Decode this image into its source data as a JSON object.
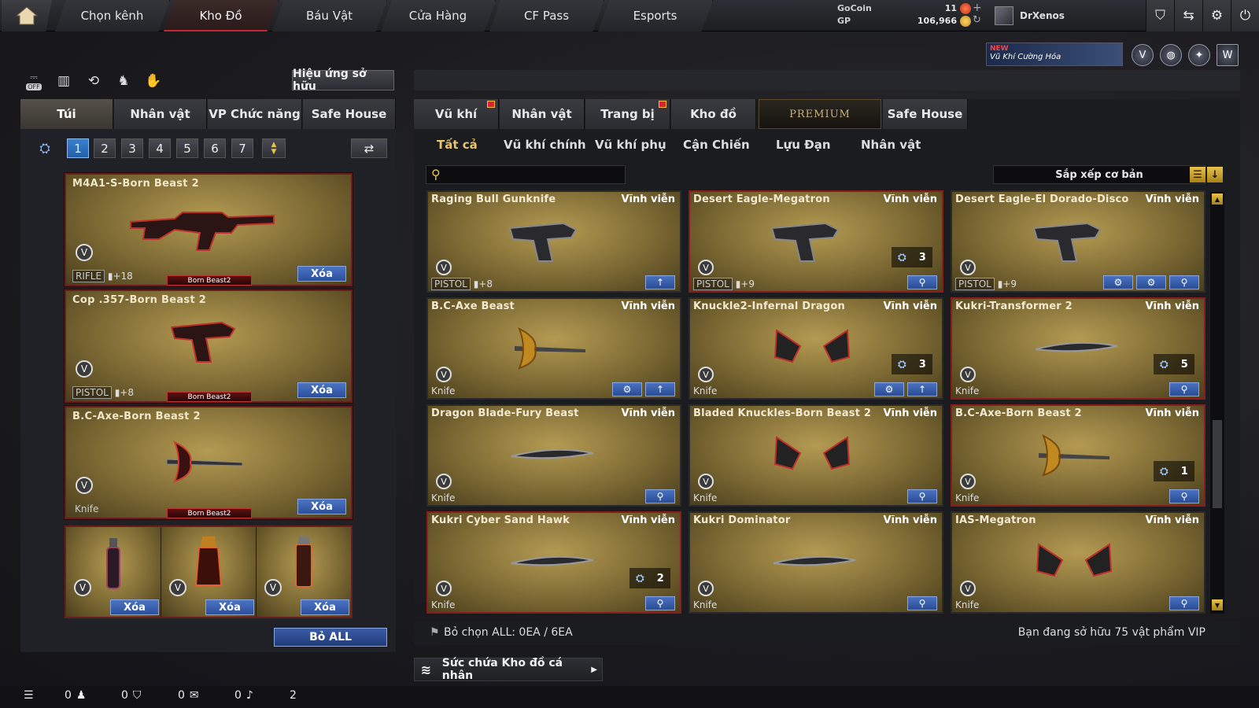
{
  "nav": {
    "tabs": [
      "Chọn kênh",
      "Kho Đồ",
      "Báu Vật",
      "Cửa Hàng",
      "CF Pass",
      "Esports"
    ],
    "active": "Kho Đồ"
  },
  "currency": {
    "gocoin_label": "GoCoin",
    "gp_label": "GP",
    "gocoin_value": "11",
    "gp_value": "106,966"
  },
  "user": {
    "name": "DrXenos"
  },
  "promo": {
    "badge": "NEW",
    "text": "Vũ Khí Cường Hóa"
  },
  "left": {
    "effect_button": "Hiệu ứng sở hữu",
    "toggle_label": "OFF",
    "tabs": [
      "Túi",
      "Nhân vật",
      "VP Chức năng",
      "Safe House"
    ],
    "slots": [
      "1",
      "2",
      "3",
      "4",
      "5",
      "6",
      "7"
    ],
    "cards": [
      {
        "name": "M4A1-S-Born Beast 2",
        "cat": "RIFLE",
        "lvl": "+18",
        "tag": "Born Beast2",
        "del": "Xóa"
      },
      {
        "name": "Cop .357-Born Beast 2",
        "cat": "PISTOL",
        "lvl": "+8",
        "tag": "Born Beast2",
        "del": "Xóa"
      },
      {
        "name": "B.C-Axe-Born Beast 2",
        "cat": "Knife",
        "lvl": "",
        "tag": "Born Beast2",
        "del": "Xóa"
      }
    ],
    "grenades": [
      {
        "del": "Xóa"
      },
      {
        "del": "Xóa"
      },
      {
        "del": "Xóa"
      }
    ],
    "bo_all": "Bỏ ALL"
  },
  "right": {
    "tabs": [
      "Vũ khí",
      "Nhân vật",
      "Trang bị",
      "Kho đồ",
      "PREMIUM",
      "Safe House"
    ],
    "subtabs": [
      "Tất cả",
      "Vũ khí chính",
      "Vũ khí phụ",
      "Cận Chiến",
      "Lựu Đạn",
      "Nhân vật"
    ],
    "sort_label": "Sắp xếp cơ bản",
    "items": [
      {
        "name": "Raging Bull Gunknife",
        "perm": "Vĩnh viễn",
        "cat": "PISTOL",
        "lvl": "+8",
        "qty": ""
      },
      {
        "name": "Desert Eagle-Megatron",
        "perm": "Vĩnh viễn",
        "cat": "PISTOL",
        "lvl": "+9",
        "qty": "3"
      },
      {
        "name": "Desert Eagle-El Dorado-Disco",
        "perm": "Vĩnh viễn",
        "cat": "PISTOL",
        "lvl": "+9",
        "qty": ""
      },
      {
        "name": "B.C-Axe Beast",
        "perm": "Vĩnh viễn",
        "cat": "Knife",
        "lvl": "",
        "qty": ""
      },
      {
        "name": "Knuckle2-Infernal Dragon",
        "perm": "Vĩnh viễn",
        "cat": "Knife",
        "lvl": "",
        "qty": "3"
      },
      {
        "name": "Kukri-Transformer 2",
        "perm": "Vĩnh viễn",
        "cat": "Knife",
        "lvl": "",
        "qty": "5"
      },
      {
        "name": "Dragon Blade-Fury Beast",
        "perm": "Vĩnh viễn",
        "cat": "Knife",
        "lvl": "",
        "qty": ""
      },
      {
        "name": "Bladed Knuckles-Born Beast 2",
        "perm": "Vĩnh viễn",
        "cat": "Knife",
        "lvl": "",
        "qty": ""
      },
      {
        "name": "B.C-Axe-Born Beast 2",
        "perm": "Vĩnh viễn",
        "cat": "Knife",
        "lvl": "",
        "qty": "1"
      },
      {
        "name": "Kukri Cyber Sand Hawk",
        "perm": "Vĩnh viễn",
        "cat": "Knife",
        "lvl": "",
        "qty": "2"
      },
      {
        "name": "Kukri Dominator",
        "perm": "Vĩnh viễn",
        "cat": "Knife",
        "lvl": "",
        "qty": ""
      },
      {
        "name": "IAS-Megatron",
        "perm": "Vĩnh viễn",
        "cat": "Knife",
        "lvl": "",
        "qty": ""
      }
    ],
    "footer_left": "Bỏ chọn ALL: 0EA / 6EA",
    "footer_right": "Bạn đang sở hữu 75 vật phẩm VIP",
    "capacity": "Sức chứa Kho đồ cá nhân"
  },
  "status": {
    "s1": "0",
    "s2": "0",
    "s3": "0",
    "s4": "0",
    "s5": "2"
  }
}
